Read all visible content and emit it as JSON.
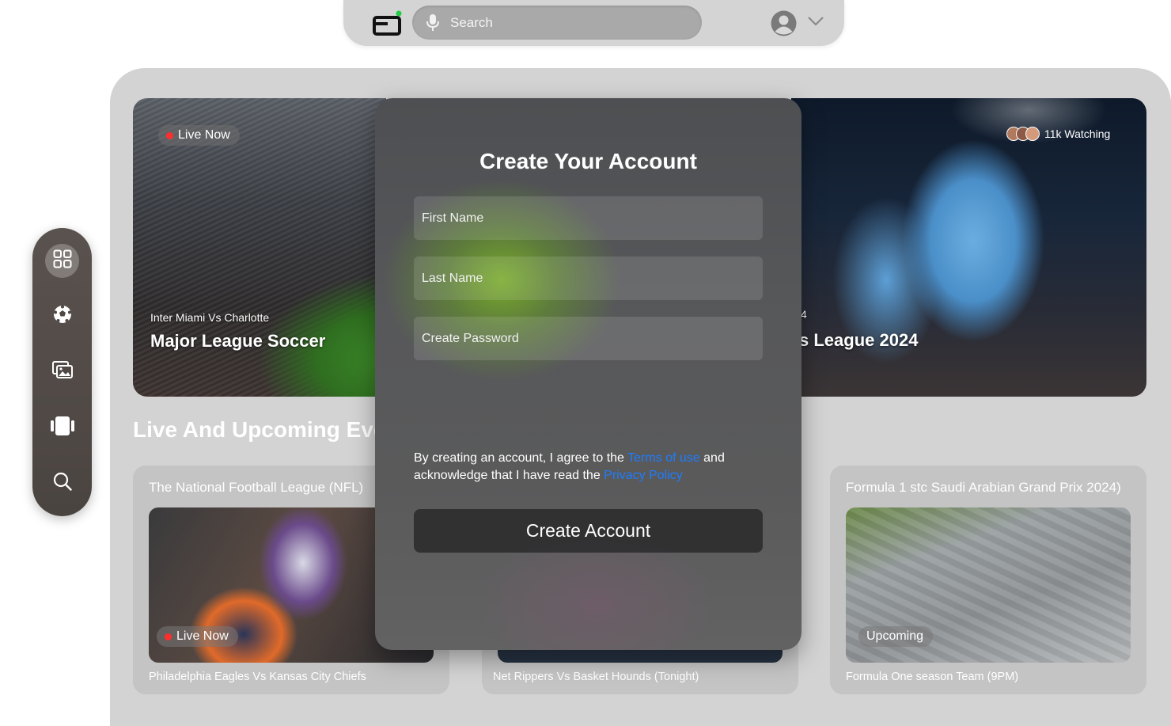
{
  "topbar": {
    "search_placeholder": "Search"
  },
  "heroes": {
    "left": {
      "badge": "Live Now",
      "subtitle": "Inter Miami Vs Charlotte",
      "title": "Major League Soccer"
    },
    "right": {
      "prefix": "4",
      "title": "s League 2024",
      "watching": "11k Watching"
    }
  },
  "section": {
    "title": "Live And Upcoming Eve"
  },
  "cards": [
    {
      "title": "The National Football League (NFL)",
      "badge": "Live Now",
      "footer": "Philadelphia Eagles Vs Kansas City Chiefs"
    },
    {
      "title": "",
      "badge": "",
      "footer": "Net Rippers Vs Basket Hounds (Tonight)"
    },
    {
      "title": "Formula 1 stc Saudi Arabian Grand Prix 2024)",
      "badge": "Upcoming",
      "footer": "Formula One season Team (9PM)"
    }
  ],
  "modal": {
    "title": "Create Your Account",
    "first_name_placeholder": "First Name",
    "last_name_placeholder": "Last Name",
    "password_placeholder": "Create Password",
    "terms_prefix": "By creating an account, I agree to the ",
    "terms_link": "Terms of use",
    "terms_mid": " and acknowledge that I have read the ",
    "privacy_link": "Privacy Policy",
    "submit_label": "Create Account"
  },
  "colors": {
    "accent_link": "#1e7cff",
    "live_dot": "#ff2d2d",
    "logo_dot": "#22cc44"
  },
  "icons": {
    "dock": [
      "grid-icon",
      "soccer-ball-icon",
      "gallery-icon",
      "cards-icon",
      "search-icon"
    ],
    "topbar": [
      "logo-icon",
      "mic-icon",
      "user-avatar-icon",
      "chevron-down-icon"
    ]
  }
}
